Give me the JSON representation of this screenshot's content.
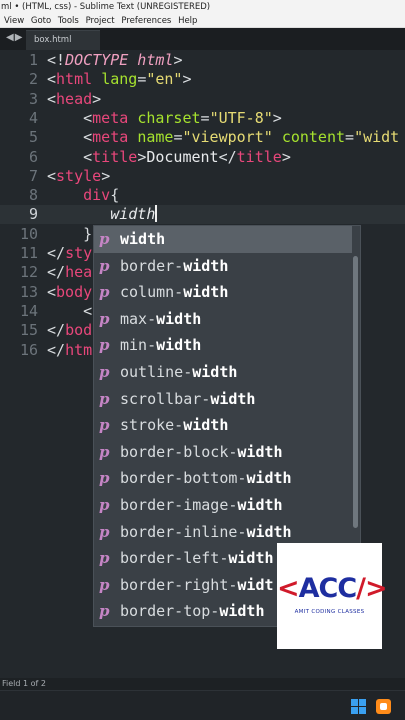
{
  "window": {
    "title": "ml • (HTML, css) - Sublime Text (UNREGISTERED)"
  },
  "menu": [
    "View",
    "Goto",
    "Tools",
    "Project",
    "Preferences",
    "Help"
  ],
  "tabs": [
    {
      "label": "box.html"
    }
  ],
  "nav": {
    "back": "◀",
    "forward": "▶"
  },
  "editor": {
    "lines": [
      {
        "n": "1",
        "tokens": [
          [
            "punc",
            "<!"
          ],
          [
            "kw",
            "DOCTYPE html"
          ],
          [
            "punc",
            ">"
          ]
        ]
      },
      {
        "n": "2",
        "tokens": [
          [
            "punc",
            "<"
          ],
          [
            "tag",
            "html"
          ],
          [
            "txt",
            " "
          ],
          [
            "attr",
            "lang"
          ],
          [
            "punc",
            "="
          ],
          [
            "str",
            "\"en\""
          ],
          [
            "punc",
            ">"
          ]
        ]
      },
      {
        "n": "3",
        "tokens": [
          [
            "punc",
            "<"
          ],
          [
            "tag",
            "head"
          ],
          [
            "punc",
            ">"
          ]
        ]
      },
      {
        "n": "4",
        "tokens": [
          [
            "txt",
            "    "
          ],
          [
            "punc",
            "<"
          ],
          [
            "tag",
            "meta"
          ],
          [
            "txt",
            " "
          ],
          [
            "attr",
            "charset"
          ],
          [
            "punc",
            "="
          ],
          [
            "str",
            "\"UTF-8\""
          ],
          [
            "punc",
            ">"
          ]
        ]
      },
      {
        "n": "5",
        "tokens": [
          [
            "txt",
            "    "
          ],
          [
            "punc",
            "<"
          ],
          [
            "tag",
            "meta"
          ],
          [
            "txt",
            " "
          ],
          [
            "attr",
            "name"
          ],
          [
            "punc",
            "="
          ],
          [
            "str",
            "\"viewport\""
          ],
          [
            "txt",
            " "
          ],
          [
            "attr",
            "content"
          ],
          [
            "punc",
            "="
          ],
          [
            "str",
            "\"widt"
          ]
        ]
      },
      {
        "n": "6",
        "tokens": [
          [
            "txt",
            "    "
          ],
          [
            "punc",
            "<"
          ],
          [
            "tag",
            "title"
          ],
          [
            "punc",
            ">"
          ],
          [
            "txt",
            "Document"
          ],
          [
            "punc",
            "</"
          ],
          [
            "tag",
            "title"
          ],
          [
            "punc",
            ">"
          ]
        ]
      },
      {
        "n": "7",
        "tokens": [
          [
            "punc",
            "<"
          ],
          [
            "tag",
            "style"
          ],
          [
            "punc",
            ">"
          ]
        ]
      },
      {
        "n": "8",
        "tokens": [
          [
            "txt",
            "    "
          ],
          [
            "tag",
            "div"
          ],
          [
            "punc",
            "{"
          ]
        ]
      },
      {
        "n": "9",
        "tokens": [
          [
            "txt",
            "       "
          ],
          [
            "prop",
            "width"
          ]
        ],
        "cursor": true
      },
      {
        "n": "10",
        "tokens": [
          [
            "txt",
            "    "
          ],
          [
            "punc",
            "}"
          ]
        ]
      },
      {
        "n": "11",
        "tokens": [
          [
            "punc",
            "</"
          ],
          [
            "tag",
            "sty"
          ]
        ]
      },
      {
        "n": "12",
        "tokens": [
          [
            "punc",
            "</"
          ],
          [
            "tag",
            "hea"
          ]
        ]
      },
      {
        "n": "13",
        "tokens": [
          [
            "punc",
            "<"
          ],
          [
            "tag",
            "body"
          ]
        ]
      },
      {
        "n": "14",
        "tokens": [
          [
            "txt",
            "    "
          ],
          [
            "punc",
            "<"
          ]
        ]
      },
      {
        "n": "15",
        "tokens": [
          [
            "punc",
            "</"
          ],
          [
            "tag",
            "bod"
          ]
        ]
      },
      {
        "n": "16",
        "tokens": [
          [
            "punc",
            "</"
          ],
          [
            "tag",
            "htm"
          ]
        ]
      }
    ]
  },
  "autocomplete": {
    "kind_glyph": "p",
    "items": [
      {
        "pre": "",
        "match": "width"
      },
      {
        "pre": "border-",
        "match": "width"
      },
      {
        "pre": "column-",
        "match": "width"
      },
      {
        "pre": "max-",
        "match": "width"
      },
      {
        "pre": "min-",
        "match": "width"
      },
      {
        "pre": "outline-",
        "match": "width"
      },
      {
        "pre": "scrollbar-",
        "match": "width"
      },
      {
        "pre": "stroke-",
        "match": "width"
      },
      {
        "pre": "border-block-",
        "match": "width"
      },
      {
        "pre": "border-bottom-",
        "match": "width"
      },
      {
        "pre": "border-image-",
        "match": "width"
      },
      {
        "pre": "border-inline-",
        "match": "width"
      },
      {
        "pre": "border-left-",
        "match": "width"
      },
      {
        "pre": "border-right-",
        "match": "widt"
      },
      {
        "pre": "border-top-",
        "match": "width"
      }
    ]
  },
  "logo": {
    "left": "<",
    "main": "ACC",
    "right": "/>",
    "sub": "AMIT CODING CLASSES"
  },
  "status": {
    "text": "Field 1 of 2"
  },
  "colors": {
    "background": "#23282c",
    "tag": "#e8477b",
    "attr": "#a6e22e",
    "string": "#e6db74",
    "popup": "#3a4046"
  }
}
